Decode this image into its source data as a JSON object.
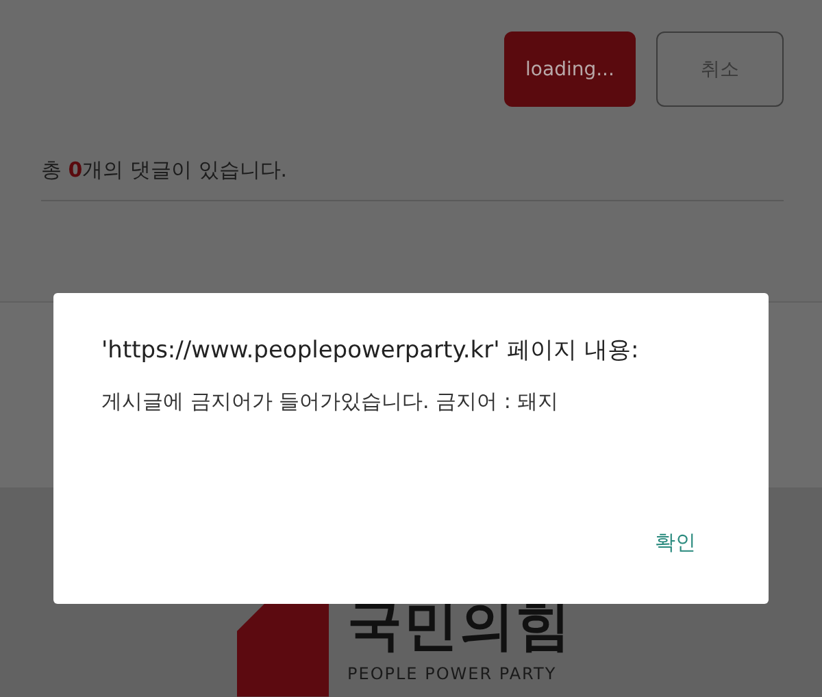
{
  "buttons": [
    {
      "label": "loading...",
      "kind": "primary"
    },
    {
      "label": "취소",
      "kind": "outline"
    }
  ],
  "comment_count": {
    "prefix": "총 ",
    "count": "0",
    "suffix": "개의 댓글이 있습니다."
  },
  "footer_logo": {
    "name": "국민의힘",
    "tagline": "PEOPLE POWER PARTY"
  },
  "dialog": {
    "title": "'https://www.peoplepowerparty.kr' 페이지 내용:",
    "message": "게시글에 금지어가 들어가있습니다. 금지어 :  돼지",
    "buttons": [
      "확인"
    ]
  }
}
